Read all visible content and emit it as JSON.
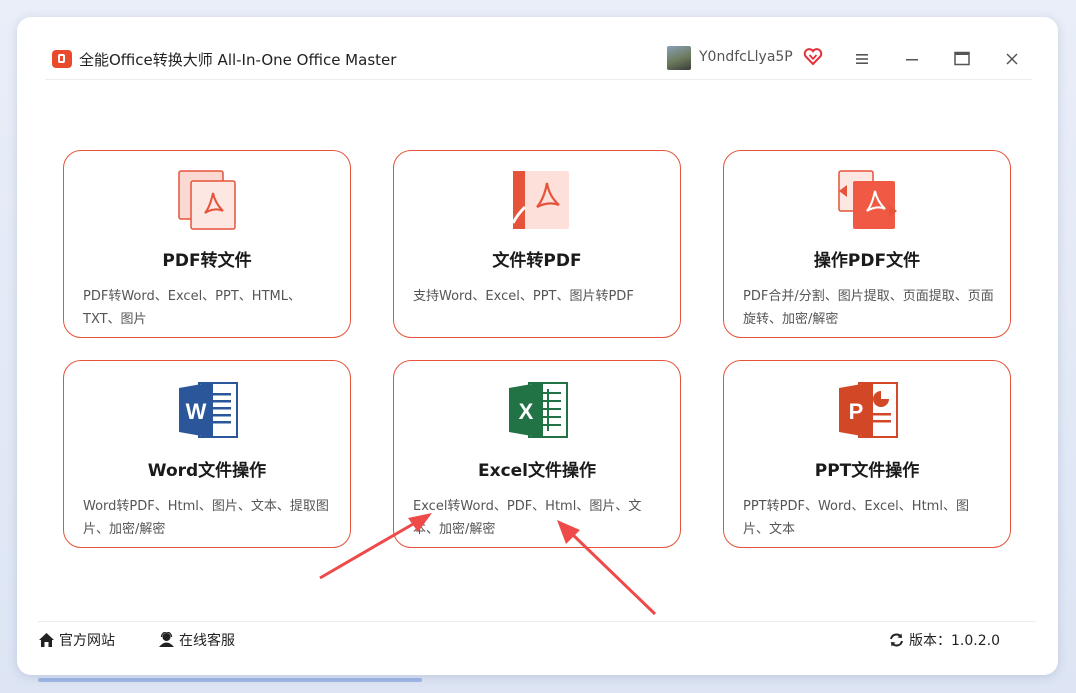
{
  "window": {
    "title": "全能Office转换大师 All-In-One Office Master",
    "username": "Y0ndfcLlya5P"
  },
  "cards": [
    {
      "title": "PDF转文件",
      "desc": "PDF转Word、Excel、PPT、HTML、TXT、图片",
      "icon": "pdf-to-file-icon"
    },
    {
      "title": "文件转PDF",
      "desc": "支持Word、Excel、PPT、图片转PDF",
      "icon": "file-to-pdf-icon"
    },
    {
      "title": "操作PDF文件",
      "desc": "PDF合并/分割、图片提取、页面提取、页面旋转、加密/解密",
      "icon": "pdf-operate-icon"
    },
    {
      "title": "Word文件操作",
      "desc": "Word转PDF、Html、图片、文本、提取图片、加密/解密",
      "icon": "word-icon"
    },
    {
      "title": "Excel文件操作",
      "desc": "Excel转Word、PDF、Html、图片、文本、加密/解密",
      "icon": "excel-icon"
    },
    {
      "title": "PPT文件操作",
      "desc": "PPT转PDF、Word、Excel、Html、图片、文本",
      "icon": "ppt-icon"
    }
  ],
  "footer": {
    "website": "官方网站",
    "support": "在线客服",
    "version": "版本：1.0.2.0"
  },
  "colors": {
    "accent": "#e4533a",
    "word": "#2b579a",
    "excel": "#217346",
    "ppt": "#d24726"
  }
}
